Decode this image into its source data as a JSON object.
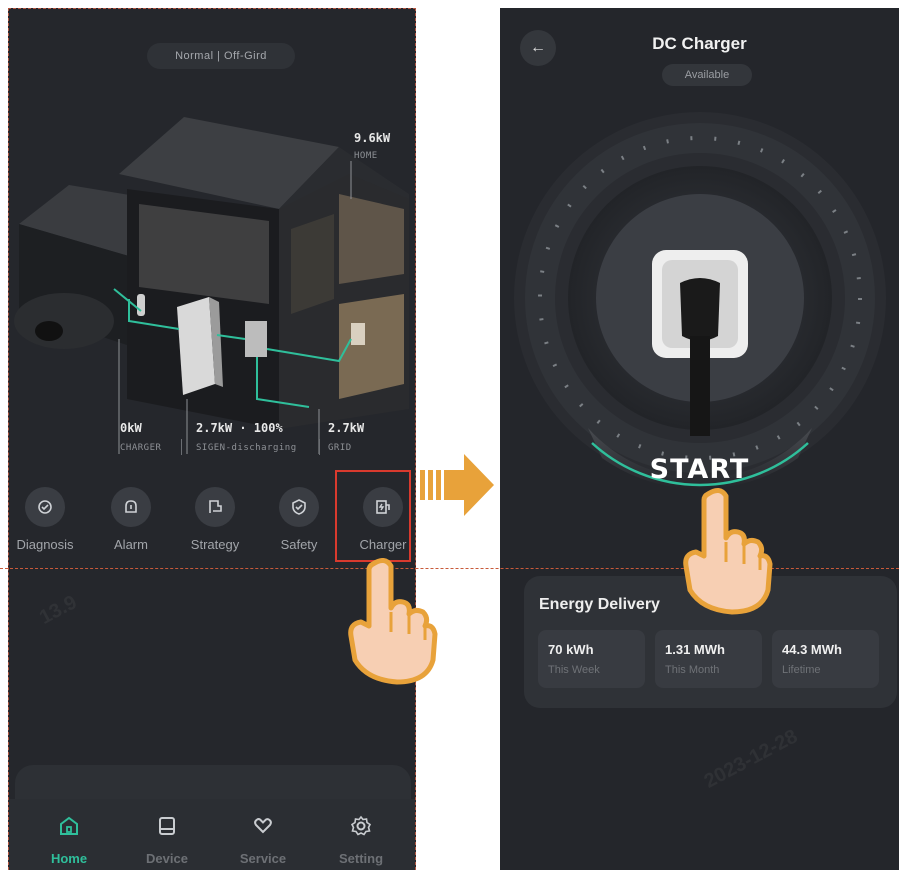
{
  "left_screen": {
    "mode_pill": "Normal  |  Off-Gird",
    "home_stat": {
      "value": "9.6kW",
      "label": "HOME"
    },
    "charger_stat": {
      "value": "0kW",
      "label": "CHARGER"
    },
    "sigen_stat": {
      "value": "2.7kW · 100%",
      "label": "SIGEN-discharging"
    },
    "grid_stat": {
      "value": "2.7kW",
      "label": "GRID"
    },
    "quick_actions": [
      {
        "label": "Diagnosis",
        "icon": "diagnosis-icon"
      },
      {
        "label": "Alarm",
        "icon": "alarm-icon"
      },
      {
        "label": "Strategy",
        "icon": "strategy-icon"
      },
      {
        "label": "Safety",
        "icon": "safety-icon"
      },
      {
        "label": "Charger",
        "icon": "charger-icon"
      }
    ],
    "tabs": [
      {
        "label": "Home",
        "icon": "home-icon",
        "active": true
      },
      {
        "label": "Device",
        "icon": "device-icon",
        "active": false
      },
      {
        "label": "Service",
        "icon": "service-icon",
        "active": false
      },
      {
        "label": "Setting",
        "icon": "setting-icon",
        "active": false
      }
    ]
  },
  "right_screen": {
    "title": "DC Charger",
    "status": "Available",
    "start_label": "START",
    "energy_delivery": {
      "title": "Energy Delivery",
      "metrics": [
        {
          "value": "70 kWh",
          "label": "This Week"
        },
        {
          "value": "1.31 MWh",
          "label": "This Month"
        },
        {
          "value": "44.3 MWh",
          "label": "Lifetime"
        }
      ]
    }
  },
  "colors": {
    "accent": "#2fbf9b",
    "highlight_box": "#d93a2e",
    "arrow": "#e8a23a",
    "background": "#24262b"
  }
}
